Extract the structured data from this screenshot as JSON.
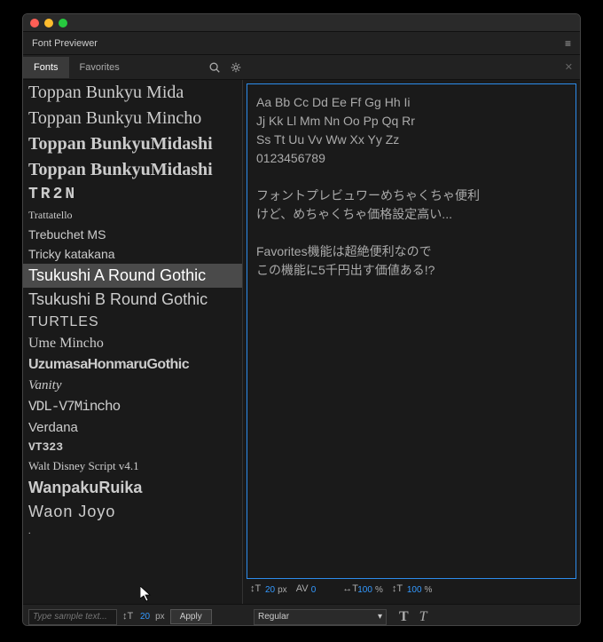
{
  "window": {
    "title": "Font Previewer"
  },
  "tabs": {
    "fonts": "Fonts",
    "favorites": "Favorites"
  },
  "fonts": [
    "Toppan Bunkyu Mida",
    "Toppan Bunkyu Mincho",
    "Toppan BunkyuMidashi",
    "Toppan BunkyuMidashi",
    "TR2N",
    "Trattatello",
    "Trebuchet MS",
    "Tricky katakana",
    "Tsukushi A Round Gothic",
    "Tsukushi B Round Gothic",
    "TURTLES",
    "Ume Mincho",
    "UzumasaHonmaruGothic",
    "Vanity",
    "VDL-V7Mincho",
    "Verdana",
    "VT323",
    "Walt Disney Script v4.1",
    "WanpakuRuika",
    "Waon Joyo",
    "."
  ],
  "selected_font_index": 8,
  "preview": {
    "line1": "Aa Bb Cc Dd Ee Ff Gg Hh Ii",
    "line2": "Jj Kk Ll Mm Nn Oo Pp Qq Rr",
    "line3": "Ss Tt Uu Vv Ww Xx Yy Zz",
    "line4": "0123456789",
    "line5": "",
    "line6": "フォントプレビュワーめちゃくちゃ便利",
    "line7": "けど、めちゃくちゃ価格設定高い...",
    "line8": "",
    "line9": "Favorites機能は超絶便利なので",
    "line10": "この機能に5千円出す価値ある!?"
  },
  "controls": {
    "font_size": "20",
    "font_size_unit": "px",
    "tracking": "0",
    "scale_h": "100",
    "scale_h_unit": "%",
    "scale_v": "100",
    "scale_v_unit": "%"
  },
  "bottom": {
    "sample_placeholder": "Type sample text...",
    "list_size": "20",
    "list_size_unit": "px",
    "apply": "Apply",
    "style": "Regular"
  }
}
